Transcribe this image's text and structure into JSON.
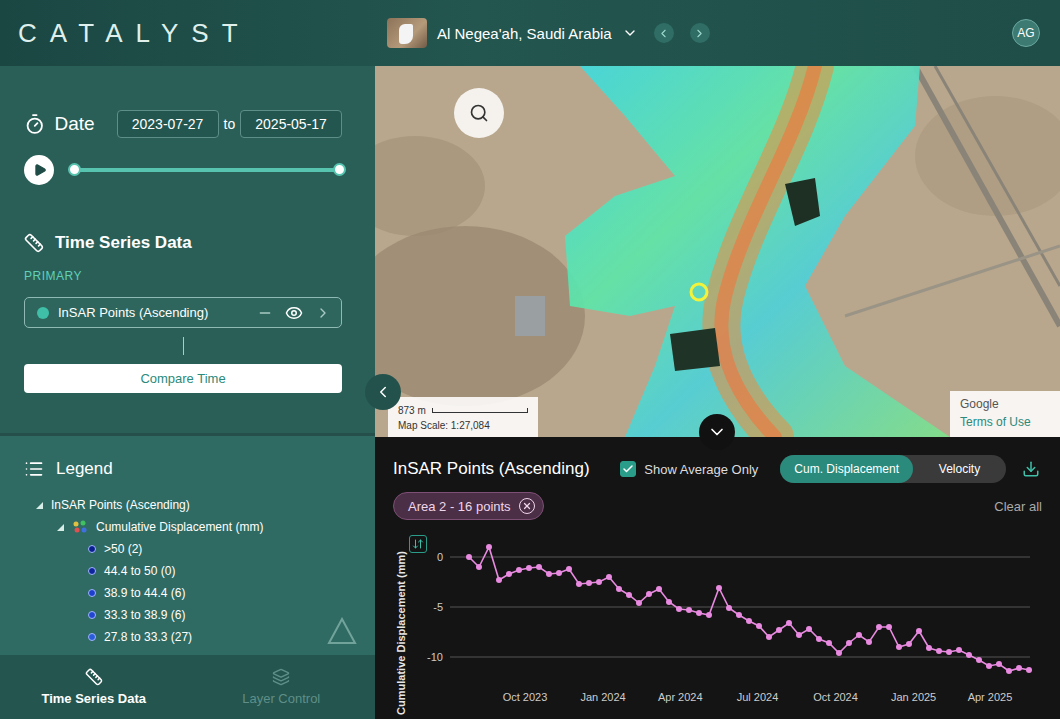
{
  "header": {
    "logo": "CATALYST",
    "location": "Al Negea'ah, Saudi Arabia",
    "avatar": "AG"
  },
  "date": {
    "label": "Date",
    "start": "2023-07-27",
    "separator": "to",
    "end": "2025-05-17",
    "playing": false,
    "range_start": 0,
    "range_end": 1
  },
  "time_series": {
    "title": "Time Series Data",
    "group": "PRIMARY",
    "layers": [
      {
        "name": "InSAR Points (Ascending)",
        "visible": true
      }
    ],
    "compare_button": "Compare Time"
  },
  "legend": {
    "title": "Legend",
    "layer": "InSAR Points (Ascending)",
    "layer_expanded": true,
    "group": "Cumulative Displacement (mm)",
    "group_expanded": true,
    "items": [
      {
        "label": ">50 (2)",
        "color": "#0b1f8f"
      },
      {
        "label": "44.4 to 50 (0)",
        "color": "#10249e"
      },
      {
        "label": "38.9 to 44.4 (6)",
        "color": "#1e3fcc"
      },
      {
        "label": "33.3 to 38.9 (6)",
        "color": "#2346d0"
      },
      {
        "label": "27.8 to 33.3 (27)",
        "color": "#2a5bd8"
      }
    ]
  },
  "bottom_tabs": [
    {
      "label": "Time Series Data",
      "selected": true
    },
    {
      "label": "Layer Control",
      "selected": false
    }
  ],
  "map": {
    "scale_distance": "873 m",
    "scale_text": "Map Scale: 1:27,084",
    "attribution": "Google",
    "terms": "Terms of Use"
  },
  "chart": {
    "title": "InSAR Points (Ascending)",
    "show_average_only": {
      "label": "Show Average Only",
      "checked": true
    },
    "modes": [
      {
        "label": "Cum. Displacement",
        "selected": true
      },
      {
        "label": "Velocity",
        "selected": false
      }
    ],
    "chips": [
      {
        "label": "Area 2 - 16 points"
      }
    ],
    "clear": "Clear all",
    "y_axis_label": "Cumulative Displacement (mm)",
    "y_ticks": [
      "0",
      "-5",
      "-10"
    ],
    "x_ticks": [
      "Oct 2023",
      "Jan 2024",
      "Apr 2024",
      "Jul 2024",
      "Oct 2024",
      "Jan 2025",
      "Apr 2025"
    ],
    "series": [
      {
        "name": "Area 2",
        "values": [
          0,
          -1,
          1,
          -2.3,
          -1.7,
          -1.3,
          -1.1,
          -1,
          -1.7,
          -1.6,
          -1.2,
          -2.7,
          -2.6,
          -2.5,
          -2,
          -3.2,
          -3.8,
          -4.6,
          -3.7,
          -3.2,
          -4.5,
          -5.2,
          -5.3,
          -5.6,
          -5.8,
          -3.1,
          -5.1,
          -5.8,
          -6.4,
          -6.9,
          -8,
          -7.3,
          -6.6,
          -7.8,
          -7.2,
          -8.2,
          -8.6,
          -9.6,
          -8.6,
          -7.8,
          -8.5,
          -7,
          -7,
          -9,
          -8.7,
          -7.4,
          -9.1,
          -9.4,
          -9.5,
          -9.3,
          -9.8,
          -10.3,
          -10.9,
          -10.7,
          -11.4,
          -11.1,
          -11.3
        ]
      }
    ]
  }
}
